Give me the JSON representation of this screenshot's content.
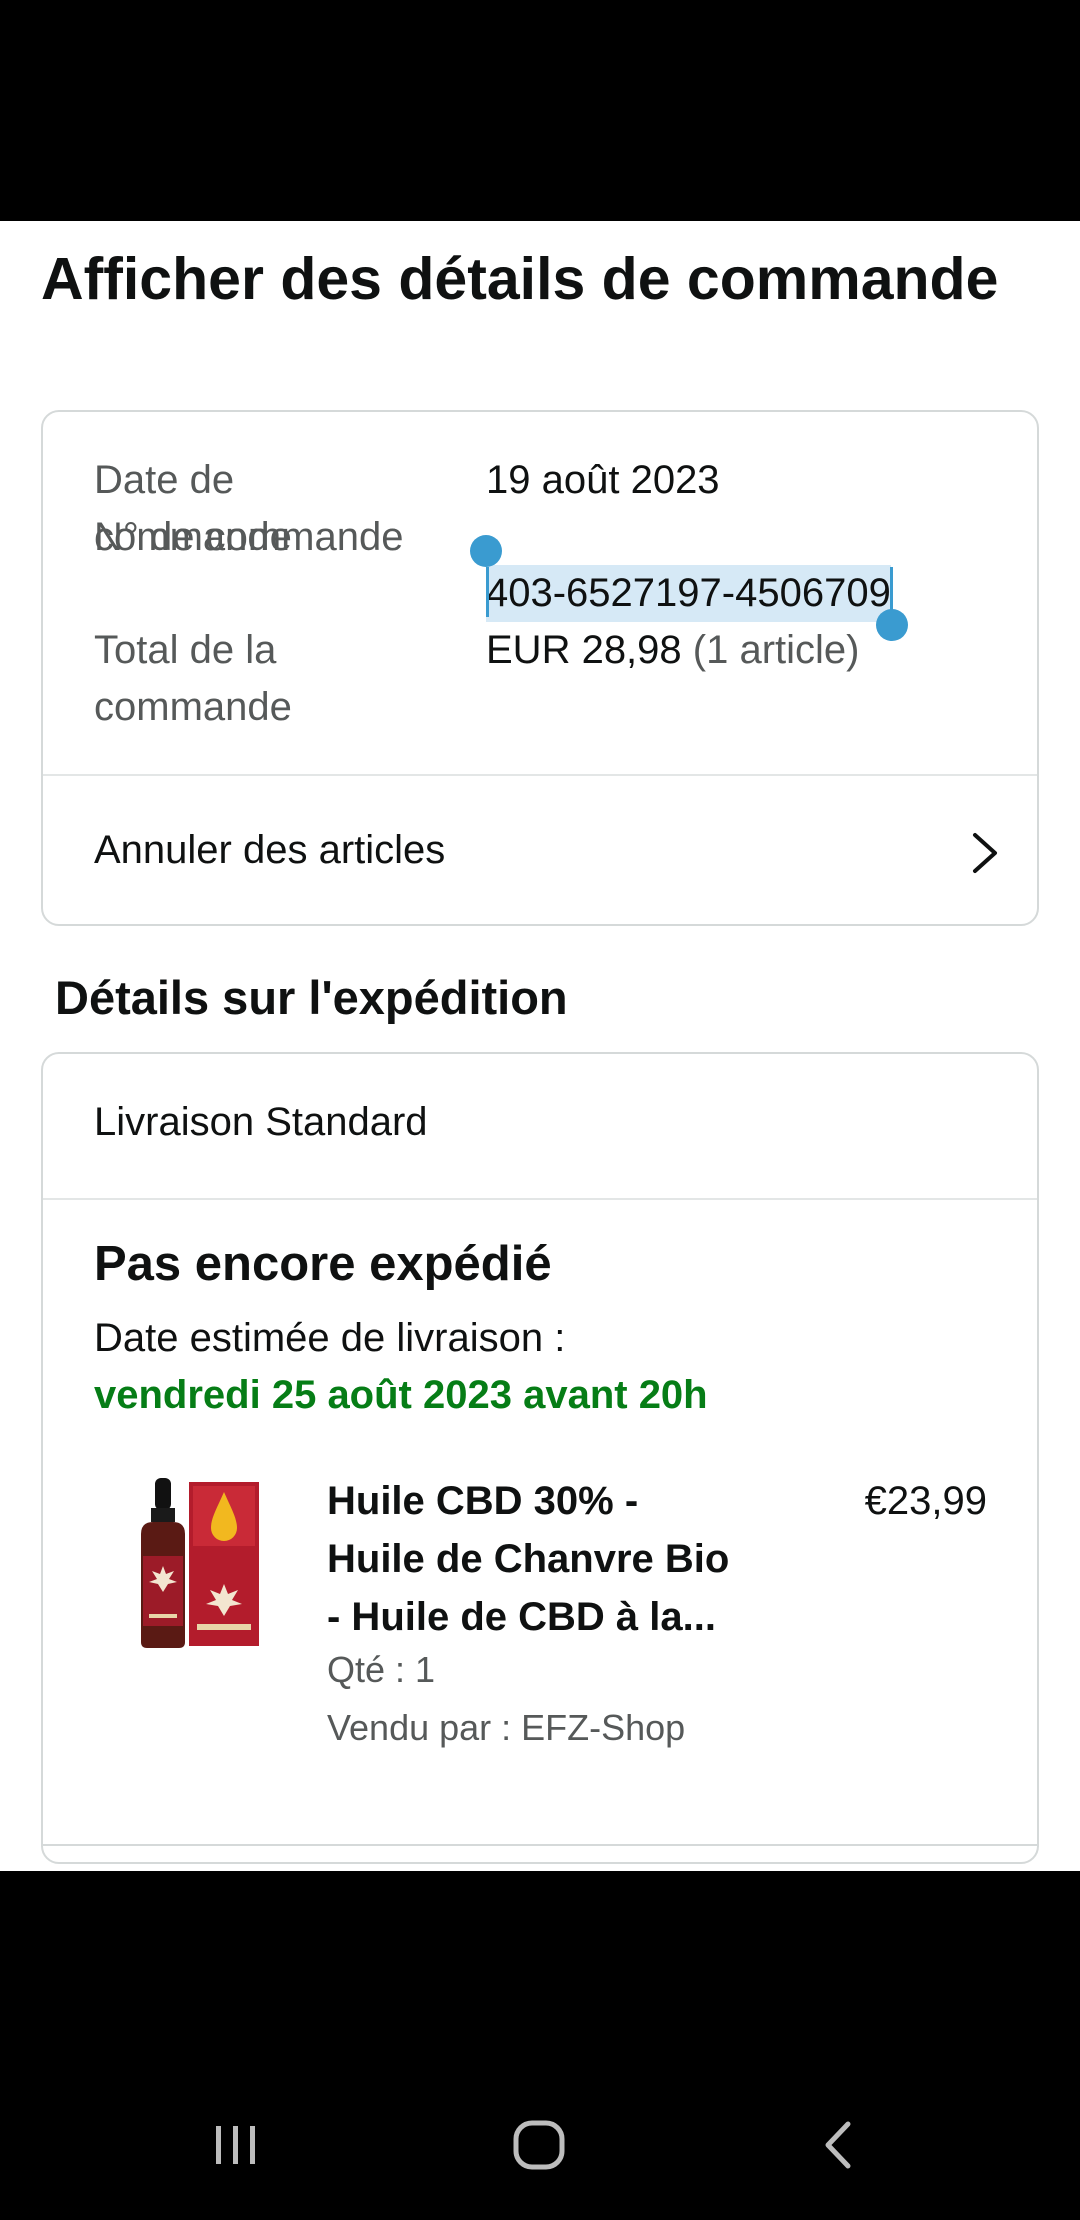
{
  "page": {
    "title": "Afficher des détails de commande"
  },
  "order_summary": {
    "date_label": "Date de commande",
    "date_value": "19 août 2023",
    "number_label": "N° de commande",
    "number_value": "403-6527197-4506709",
    "total_label": "Total de la commande",
    "total_value": "EUR 28,98",
    "total_items": "(1 article)",
    "cancel_label": "Annuler des articles",
    "cancel_icon": "chevron-right-icon"
  },
  "shipment": {
    "section_title": "Détails sur l'expédition",
    "method": "Livraison Standard",
    "status": "Pas encore expédié",
    "estimate_label": "Date estimée de livraison :",
    "estimate_date": "vendredi 25 août 2023 avant 20h",
    "estimate_color": "#067d16"
  },
  "product": {
    "title_lines": [
      "Huile CBD 30% -",
      "Huile de Chanvre Bio",
      "- Huile de CBD à la..."
    ],
    "price": "€23,99",
    "quantity": "Qté : 1",
    "seller": "Vendu par : EFZ-Shop",
    "image_icon": "cbd-oil-bottle-product-image"
  },
  "selection": {
    "color": "#3a9bd0",
    "highlight_color": "#d6e9f6"
  },
  "system_nav": {
    "recents_icon": "recents-icon",
    "home_icon": "home-icon",
    "back_icon": "back-icon"
  }
}
